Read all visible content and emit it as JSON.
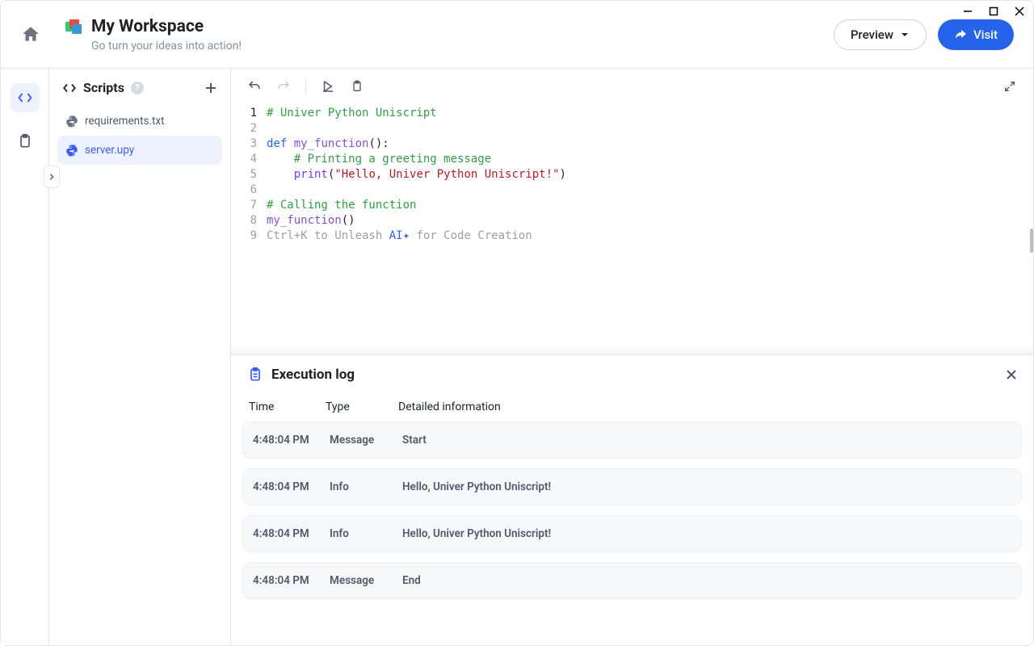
{
  "window": {
    "title": "My Workspace",
    "subtitle": "Go turn your ideas into action!"
  },
  "header": {
    "preview_label": "Preview",
    "visit_label": "Visit"
  },
  "sidebar": {
    "panel_title": "Scripts",
    "files": [
      {
        "name": "requirements.txt",
        "active": false
      },
      {
        "name": "server.upy",
        "active": true
      }
    ]
  },
  "editor": {
    "line_numbers": [
      "1",
      "2",
      "3",
      "4",
      "5",
      "6",
      "7",
      "8",
      "9"
    ],
    "lines": {
      "l1_comment": "# Univer Python Uniscript",
      "l3_def": "def",
      "l3_fn": "my_function",
      "l3_rest": "():",
      "l4_comment": "# Printing a greeting message",
      "l5_print": "print",
      "l5_str": "\"Hello, Univer Python Uniscript!\"",
      "l7_comment": "# Calling the function",
      "l8_fn": "my_function",
      "l8_rest": "()"
    },
    "hint": {
      "prefix": "Ctrl+K to Unleash ",
      "ai": "AI✦",
      "suffix": " for Code Creation"
    }
  },
  "log": {
    "title": "Execution log",
    "columns": {
      "time": "Time",
      "type": "Type",
      "detail": "Detailed information"
    },
    "rows": [
      {
        "time": "4:48:04 PM",
        "type": "Message",
        "detail": "Start"
      },
      {
        "time": "4:48:04 PM",
        "type": "Info",
        "detail": "Hello, Univer Python Uniscript!"
      },
      {
        "time": "4:48:04 PM",
        "type": "Info",
        "detail": "Hello, Univer Python Uniscript!"
      },
      {
        "time": "4:48:04 PM",
        "type": "Message",
        "detail": "End"
      }
    ]
  }
}
